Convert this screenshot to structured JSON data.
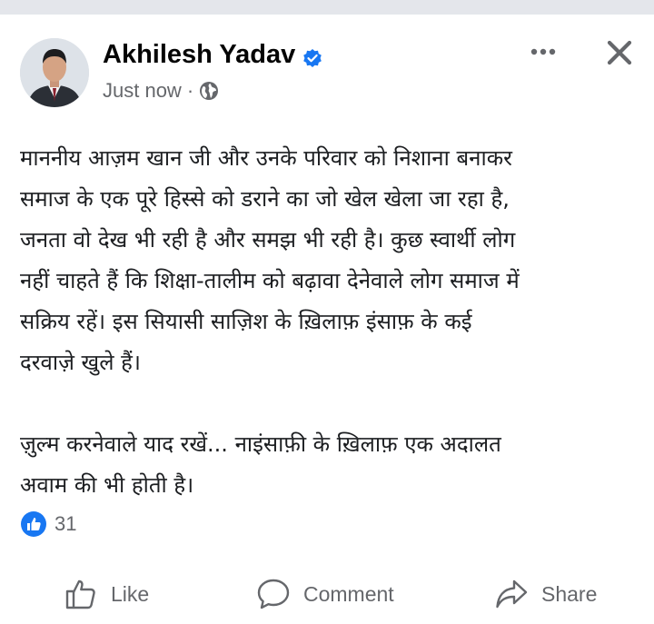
{
  "post": {
    "author_name": "Akhilesh Yadav",
    "verified": true,
    "timestamp": "Just now",
    "separator": "·",
    "privacy_icon": "globe-icon",
    "text_paragraphs": [
      "माननीय आज़म खान जी और उनके परिवार को निशाना बनाकर\nसमाज के एक पूरे हिस्से को डराने का जो खेल खेला जा रहा है,\nजनता वो देख भी रही है और समझ भी रही है। कुछ स्वार्थी लोग\nनहीं चाहते हैं कि शिक्षा-तालीम को बढ़ावा देनेवाले लोग समाज में\nसक्रिय रहें। इस सियासी साज़िश के ख़िलाफ़ इंसाफ़ के कई\nदरवाज़े खुले हैं।",
      "ज़ुल्म करनेवाले याद रखें... नाइंसाफ़ी के ख़िलाफ़ एक अदालत\nअवाम की भी होती है।"
    ],
    "reaction_count": "31"
  },
  "actions": {
    "like_label": "Like",
    "comment_label": "Comment",
    "share_label": "Share"
  },
  "colors": {
    "accent": "#1877f2",
    "text": "#050505",
    "muted": "#65676b",
    "top_bar": "#e4e6eb"
  }
}
